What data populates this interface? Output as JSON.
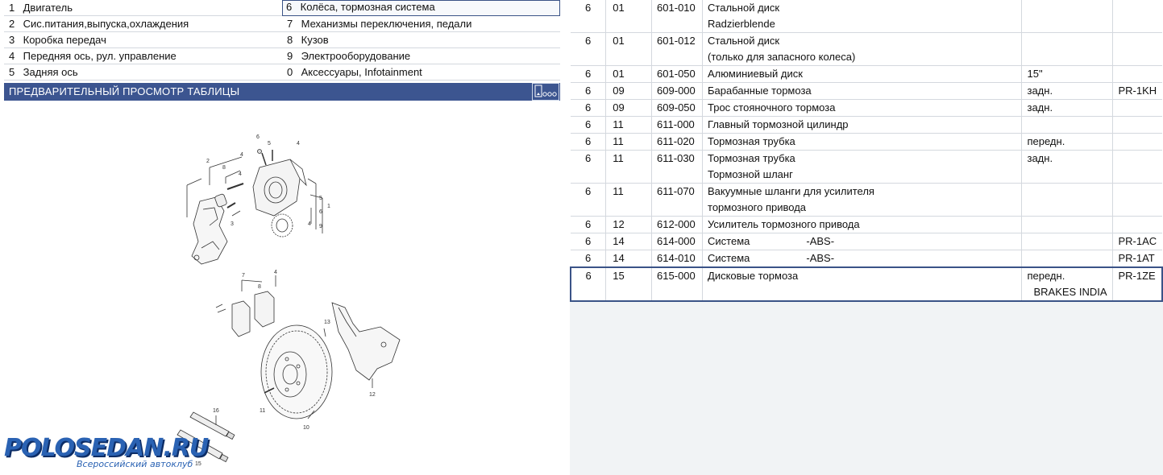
{
  "groups": [
    {
      "num": "1",
      "label": "Двигатель",
      "selected": false
    },
    {
      "num": "6",
      "label": "Колёса, тормозная система",
      "selected": true
    },
    {
      "num": "2",
      "label": "Сис.питания,выпуска,охлаждения",
      "selected": false
    },
    {
      "num": "7",
      "label": "Механизмы переключения, педали",
      "selected": false
    },
    {
      "num": "3",
      "label": "Коробка передач",
      "selected": false
    },
    {
      "num": "8",
      "label": "Кузов",
      "selected": false
    },
    {
      "num": "4",
      "label": "Передняя ось, рул. управление",
      "selected": false
    },
    {
      "num": "9",
      "label": "Электрооборудование",
      "selected": false
    },
    {
      "num": "5",
      "label": "Задняя ось",
      "selected": false
    },
    {
      "num": "0",
      "label": "Аксессуары, Infotainment",
      "selected": false
    }
  ],
  "preview": {
    "title": "ПРЕДВАРИТЕЛЬНЫЙ ПРОСМОТР ТАБЛИЦЫ"
  },
  "diagram": {
    "callouts": {
      "c1": "1",
      "c2": "2",
      "c3": "3",
      "c4a": "4",
      "c4b": "4",
      "c4c": "4",
      "c4d": "4",
      "c5a": "5",
      "c5b": "5",
      "c6a": "6",
      "c6b": "6",
      "c7": "7",
      "c8a": "8",
      "c8b": "8",
      "c9": "9",
      "c10": "10",
      "c11": "11",
      "c12": "12",
      "c13": "13",
      "c15": "15",
      "c16": "16"
    }
  },
  "logo": {
    "main": "POLOSEDAN.RU",
    "sub": "Всероссийский автоклуб"
  },
  "table": {
    "rows": [
      {
        "hg": "6",
        "sg": "01",
        "code": "601-010",
        "desc": [
          "Стальной диск",
          "Radzierblende"
        ],
        "note": "",
        "pr": ""
      },
      {
        "hg": "6",
        "sg": "01",
        "code": "601-012",
        "desc": [
          "Стальной диск",
          "(только для запасного колеса)"
        ],
        "note": "",
        "pr": ""
      },
      {
        "hg": "6",
        "sg": "01",
        "code": "601-050",
        "desc": [
          "Алюминиевый диск"
        ],
        "note": "15\"",
        "pr": ""
      },
      {
        "hg": "6",
        "sg": "09",
        "code": "609-000",
        "desc": [
          "Барабанные тормоза"
        ],
        "note": "задн.",
        "pr": "PR-1KH"
      },
      {
        "hg": "6",
        "sg": "09",
        "code": "609-050",
        "desc": [
          "Трос стояночного тормоза"
        ],
        "note": "задн.",
        "pr": ""
      },
      {
        "hg": "6",
        "sg": "11",
        "code": "611-000",
        "desc": [
          "Главный тормозной цилиндр"
        ],
        "note": "",
        "pr": ""
      },
      {
        "hg": "6",
        "sg": "11",
        "code": "611-020",
        "desc": [
          "Тормозная трубка"
        ],
        "note": "передн.",
        "pr": ""
      },
      {
        "hg": "6",
        "sg": "11",
        "code": "611-030",
        "desc": [
          "Тормозная трубка",
          "Тормозной шланг"
        ],
        "note": "задн.",
        "pr": ""
      },
      {
        "hg": "6",
        "sg": "11",
        "code": "611-070",
        "desc": [
          "Вакуумные шланги для усилителя",
          "тормозного привода"
        ],
        "note": "",
        "pr": ""
      },
      {
        "hg": "6",
        "sg": "12",
        "code": "612-000",
        "desc": [
          "Усилитель тормозного привода"
        ],
        "note": "",
        "pr": ""
      },
      {
        "hg": "6",
        "sg": "14",
        "code": "614-000",
        "desc": [
          "Система"
        ],
        "desc_extra": "-ABS-",
        "note": "",
        "pr": "PR-1AC"
      },
      {
        "hg": "6",
        "sg": "14",
        "code": "614-010",
        "desc": [
          "Система"
        ],
        "desc_extra": "-ABS-",
        "note": "",
        "pr": "PR-1AT"
      },
      {
        "hg": "6",
        "sg": "15",
        "code": "615-000",
        "desc": [
          "Дисковые тормоза"
        ],
        "note": "передн.",
        "note2": "BRAKES INDIA",
        "pr": "PR-1ZE",
        "selected": true
      }
    ]
  }
}
